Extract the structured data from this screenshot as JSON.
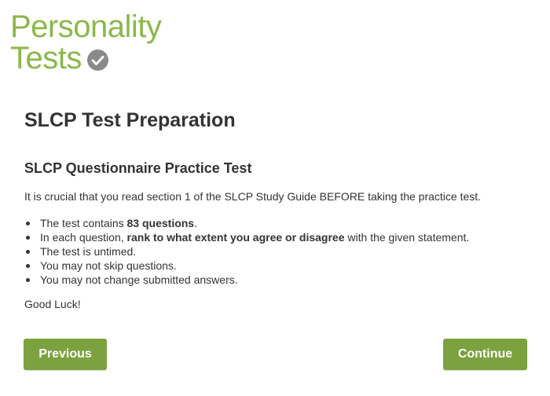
{
  "logo": {
    "line1": "Personality",
    "line2": "Tests",
    "icon": "check-circle-icon",
    "color": "#8ab84a"
  },
  "page_title": "SLCP Test Preparation",
  "section_title": "SLCP Questionnaire Practice Test",
  "intro": "It is crucial that you read section 1 of the SLCP Study Guide BEFORE taking the practice test.",
  "rules": [
    {
      "pre": "The test contains ",
      "bold": "83 questions",
      "post": "."
    },
    {
      "pre": "In each question, ",
      "bold": "rank to what extent you agree or disagree",
      "post": " with the given statement."
    },
    {
      "pre": "The test is untimed.",
      "bold": "",
      "post": ""
    },
    {
      "pre": "You may not skip questions.",
      "bold": "",
      "post": ""
    },
    {
      "pre": "You may not change submitted answers.",
      "bold": "",
      "post": ""
    }
  ],
  "good_luck": "Good Luck!",
  "buttons": {
    "previous": "Previous",
    "continue": "Continue",
    "color": "#7ba23f"
  }
}
